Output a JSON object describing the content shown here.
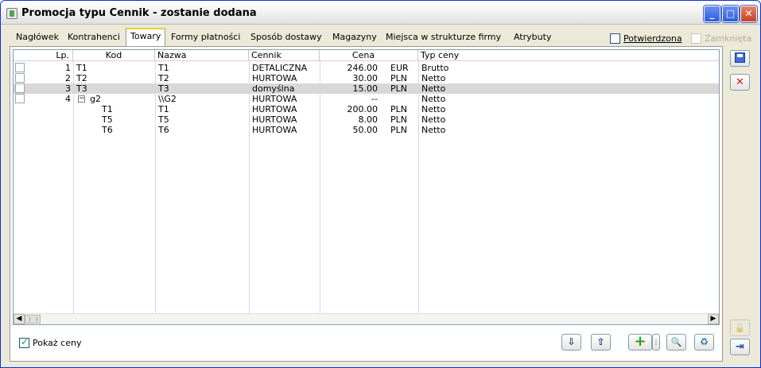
{
  "window": {
    "title": "Promocja typu Cennik - zostanie dodana",
    "controls": [
      "minimize",
      "maximize",
      "close"
    ]
  },
  "tabs": [
    {
      "label": "Nagłówek",
      "active": false
    },
    {
      "label": "Kontrahenci",
      "active": false
    },
    {
      "label": "Towary",
      "active": true
    },
    {
      "label": "Formy płatności",
      "active": false
    },
    {
      "label": "Sposób dostawy",
      "active": false
    },
    {
      "label": "Magazyny",
      "active": false
    },
    {
      "label": "Miejsca w strukturze firmy",
      "active": false
    },
    {
      "label": "Atrybuty",
      "active": false
    }
  ],
  "options": {
    "potwierdzona": {
      "label": "Potwierdzona",
      "checked": false
    },
    "zamknieta": {
      "label": "Zamknięta",
      "checked": false,
      "disabled": true
    },
    "pokaz_ceny": {
      "label": "Pokaż ceny",
      "checked": true
    }
  },
  "table": {
    "columns": {
      "lp": "Lp.",
      "kod": "Kod",
      "nazwa": "Nazwa",
      "cennik": "Cennik",
      "cena": "Cena",
      "typ": "Typ ceny"
    },
    "rows": [
      {
        "lp": "1",
        "kod": "T1",
        "nazwa": "T1",
        "cennik": "DETALICZNA",
        "cena": "246.00",
        "waluta": "EUR",
        "typ": "Brutto",
        "checkbox": true,
        "selected": false,
        "indent": false,
        "group": false
      },
      {
        "lp": "2",
        "kod": "T2",
        "nazwa": "T2",
        "cennik": "HURTOWA",
        "cena": "30.00",
        "waluta": "PLN",
        "typ": "Netto",
        "checkbox": true,
        "selected": false,
        "indent": false,
        "group": false
      },
      {
        "lp": "3",
        "kod": "T3",
        "nazwa": "T3",
        "cennik": "domyślna",
        "cena": "15.00",
        "waluta": "PLN",
        "typ": "Netto",
        "checkbox": true,
        "selected": true,
        "indent": false,
        "group": false
      },
      {
        "lp": "4",
        "kod": "g2",
        "nazwa": "\\\\G2",
        "cennik": "HURTOWA",
        "cena": "--",
        "waluta": "",
        "typ": "Netto",
        "checkbox": true,
        "selected": false,
        "indent": false,
        "group": true
      },
      {
        "lp": "",
        "kod": "T1",
        "nazwa": "T1",
        "cennik": "HURTOWA",
        "cena": "200.00",
        "waluta": "PLN",
        "typ": "Netto",
        "checkbox": false,
        "selected": false,
        "indent": true,
        "group": false
      },
      {
        "lp": "",
        "kod": "T5",
        "nazwa": "T5",
        "cennik": "HURTOWA",
        "cena": "8.00",
        "waluta": "PLN",
        "typ": "Netto",
        "checkbox": false,
        "selected": false,
        "indent": true,
        "group": false
      },
      {
        "lp": "",
        "kod": "T6",
        "nazwa": "T6",
        "cennik": "HURTOWA",
        "cena": "50.00",
        "waluta": "PLN",
        "typ": "Netto",
        "checkbox": false,
        "selected": false,
        "indent": true,
        "group": false
      }
    ]
  },
  "icons": {
    "expander": "minus-box",
    "scroll_left": "◀",
    "scroll_right": "▶"
  },
  "toolbar": {
    "move_down_icon": "⇩",
    "move_up_icon": "⇧",
    "add_icon": "+",
    "search_icon": "🔍",
    "refresh_icon": "♻"
  },
  "side": {
    "save_icon": "💾",
    "cancel_icon": "✕",
    "lock_icon": "🔓",
    "pin_icon": "⇥"
  }
}
